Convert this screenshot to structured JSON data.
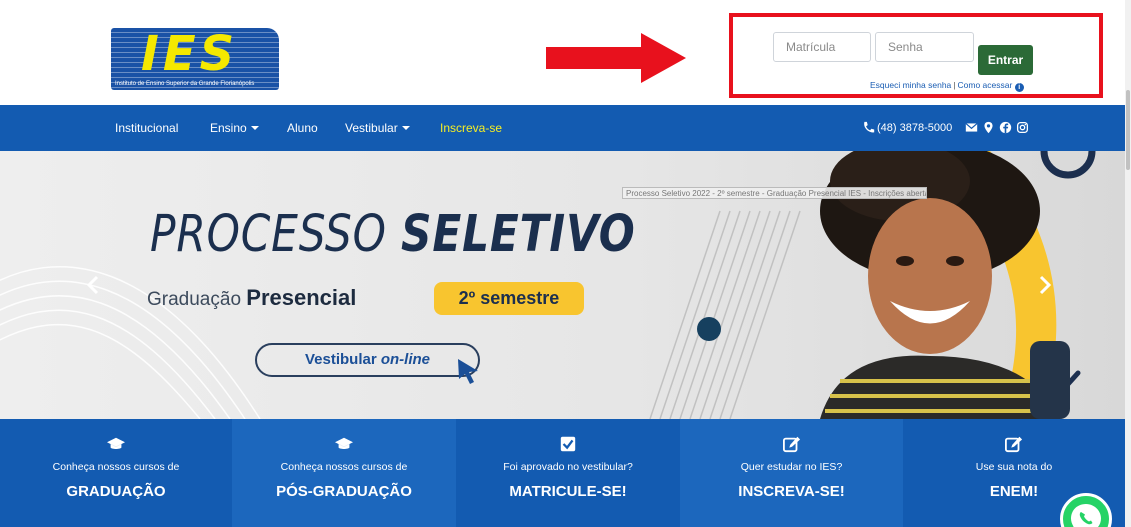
{
  "logo": {
    "letters": "IES",
    "caption": "Instituto de Ensino Superior da Grande Florianópolis"
  },
  "login": {
    "matricula_placeholder": "Matrícula",
    "senha_placeholder": "Senha",
    "entrar_label": "Entrar",
    "forgot_label": "Esqueci minha senha",
    "separator": "|",
    "how_label": "Como acessar"
  },
  "nav": {
    "items": [
      {
        "label": "Institucional"
      },
      {
        "label": "Ensino"
      },
      {
        "label": "Aluno"
      },
      {
        "label": "Vestibular"
      },
      {
        "label": "Inscreva-se"
      }
    ],
    "phone": "(48) 3878-5000"
  },
  "hero": {
    "title_light": "PROCESSO",
    "title_bold": "SELETIVO",
    "grad_prefix": "Graduação",
    "grad_bold": "Presencial",
    "semester": "2º semestre",
    "btn_prefix": "Vestibular",
    "btn_italic": "on-line",
    "tooltip": "Processo Seletivo 2022 - 2º semestre - Graduação Presencial IES - Inscrições abertas"
  },
  "cards": [
    {
      "small": "Conheça nossos cursos de",
      "big": "GRADUAÇÃO",
      "icon": "graduation-cap-icon",
      "color": "#135bb1"
    },
    {
      "small": "Conheça nossos cursos de",
      "big": "PÓS-GRADUAÇÃO",
      "icon": "graduation-cap-icon",
      "color": "#1c67bd"
    },
    {
      "small": "Foi aprovado no vestibular?",
      "big": "MATRICULE-SE!",
      "icon": "checkbox-icon",
      "color": "#135bb1"
    },
    {
      "small": "Quer estudar no IES?",
      "big": "INSCREVA-SE!",
      "icon": "edit-icon",
      "color": "#1c67bd"
    },
    {
      "small": "Use sua nota do",
      "big": "ENEM!",
      "icon": "edit-icon",
      "color": "#135bb1"
    }
  ],
  "colors": {
    "nav": "#135bb1",
    "login_highlight": "#e8111d",
    "entrar": "#2b6a37",
    "accent_yellow": "#f6ee24"
  }
}
